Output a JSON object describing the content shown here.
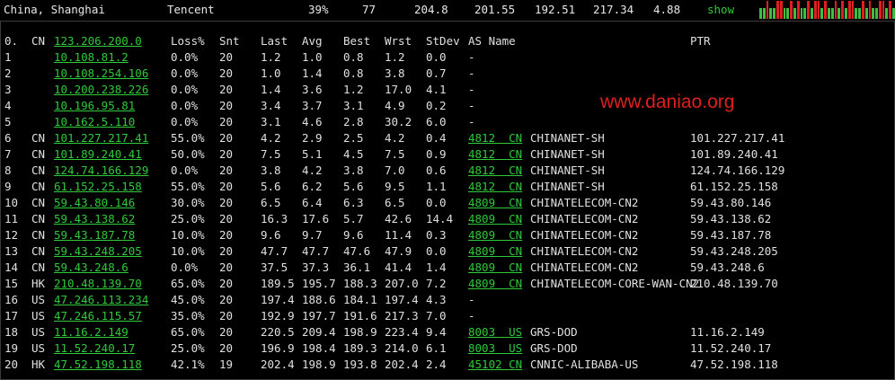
{
  "summary": {
    "location": "China, Shanghai",
    "provider": "Tencent",
    "loss": "39%",
    "sent": "77",
    "last": "204.8",
    "avg": "201.55",
    "best": "192.51",
    "worst": "217.34",
    "stdev": "4.88",
    "show_label": "show"
  },
  "mini_graph_colors": {
    "ok": "#3fbf3f",
    "loss": "#e02020"
  },
  "mini_graph": [
    1,
    1,
    0,
    1,
    1,
    0,
    0,
    1,
    1,
    0,
    1,
    0,
    1,
    1,
    0,
    1,
    0,
    0,
    1,
    0,
    1,
    1,
    0,
    1,
    0,
    1,
    0,
    0,
    1,
    1,
    0,
    1,
    0,
    1,
    1,
    0,
    0,
    1,
    0,
    1
  ],
  "header": {
    "hop": "0.",
    "cc": "CN",
    "host": "123.206.200.0",
    "loss": "Loss%",
    "snt": "Snt",
    "last": "Last",
    "avg": "Avg",
    "best": "Best",
    "wrst": "Wrst",
    "stdev": "StDev",
    "as_name": "AS Name",
    "ptr": "PTR"
  },
  "hops": [
    {
      "hop": "1",
      "cc": "",
      "host": "10.108.81.2",
      "loss": "0.0%",
      "snt": "20",
      "last": "1.2",
      "avg": "1.0",
      "best": "0.8",
      "wrst": "1.2",
      "stdev": "0.0",
      "asn": "",
      "as_name": "-",
      "ptr": ""
    },
    {
      "hop": "2",
      "cc": "",
      "host": "10.108.254.106",
      "loss": "0.0%",
      "snt": "20",
      "last": "1.0",
      "avg": "1.4",
      "best": "0.8",
      "wrst": "3.8",
      "stdev": "0.7",
      "asn": "",
      "as_name": "-",
      "ptr": ""
    },
    {
      "hop": "3",
      "cc": "",
      "host": "10.200.238.226",
      "loss": "0.0%",
      "snt": "20",
      "last": "1.4",
      "avg": "3.6",
      "best": "1.2",
      "wrst": "17.0",
      "stdev": "4.1",
      "asn": "",
      "as_name": "-",
      "ptr": ""
    },
    {
      "hop": "4",
      "cc": "",
      "host": "10.196.95.81",
      "loss": "0.0%",
      "snt": "20",
      "last": "3.4",
      "avg": "3.7",
      "best": "3.1",
      "wrst": "4.9",
      "stdev": "0.2",
      "asn": "",
      "as_name": "-",
      "ptr": ""
    },
    {
      "hop": "5",
      "cc": "",
      "host": "10.162.5.110",
      "loss": "0.0%",
      "snt": "20",
      "last": "3.1",
      "avg": "4.6",
      "best": "2.8",
      "wrst": "30.2",
      "stdev": "6.0",
      "asn": "",
      "as_name": "-",
      "ptr": ""
    },
    {
      "hop": "6",
      "cc": "CN",
      "host": "101.227.217.41",
      "loss": "55.0%",
      "snt": "20",
      "last": "4.2",
      "avg": "2.9",
      "best": "2.5",
      "wrst": "4.2",
      "stdev": "0.4",
      "asn": "4812  CN",
      "as_name": "CHINANET-SH",
      "ptr": "101.227.217.41"
    },
    {
      "hop": "7",
      "cc": "CN",
      "host": "101.89.240.41",
      "loss": "50.0%",
      "snt": "20",
      "last": "7.5",
      "avg": "5.1",
      "best": "4.5",
      "wrst": "7.5",
      "stdev": "0.9",
      "asn": "4812  CN",
      "as_name": "CHINANET-SH",
      "ptr": "101.89.240.41"
    },
    {
      "hop": "8",
      "cc": "CN",
      "host": "124.74.166.129",
      "loss": "0.0%",
      "snt": "20",
      "last": "3.8",
      "avg": "4.2",
      "best": "3.8",
      "wrst": "7.0",
      "stdev": "0.6",
      "asn": "4812  CN",
      "as_name": "CHINANET-SH",
      "ptr": "124.74.166.129"
    },
    {
      "hop": "9",
      "cc": "CN",
      "host": "61.152.25.158",
      "loss": "55.0%",
      "snt": "20",
      "last": "5.6",
      "avg": "6.2",
      "best": "5.6",
      "wrst": "9.5",
      "stdev": "1.1",
      "asn": "4812  CN",
      "as_name": "CHINANET-SH",
      "ptr": "61.152.25.158"
    },
    {
      "hop": "10",
      "cc": "CN",
      "host": "59.43.80.146",
      "loss": "30.0%",
      "snt": "20",
      "last": "6.5",
      "avg": "6.4",
      "best": "6.3",
      "wrst": "6.5",
      "stdev": "0.0",
      "asn": "4809  CN",
      "as_name": "CHINATELECOM-CN2",
      "ptr": "59.43.80.146"
    },
    {
      "hop": "11",
      "cc": "CN",
      "host": "59.43.138.62",
      "loss": "25.0%",
      "snt": "20",
      "last": "16.3",
      "avg": "17.6",
      "best": "5.7",
      "wrst": "42.6",
      "stdev": "14.4",
      "asn": "4809  CN",
      "as_name": "CHINATELECOM-CN2",
      "ptr": "59.43.138.62"
    },
    {
      "hop": "12",
      "cc": "CN",
      "host": "59.43.187.78",
      "loss": "10.0%",
      "snt": "20",
      "last": "9.6",
      "avg": "9.7",
      "best": "9.6",
      "wrst": "11.4",
      "stdev": "0.3",
      "asn": "4809  CN",
      "as_name": "CHINATELECOM-CN2",
      "ptr": "59.43.187.78"
    },
    {
      "hop": "13",
      "cc": "CN",
      "host": "59.43.248.205",
      "loss": "10.0%",
      "snt": "20",
      "last": "47.7",
      "avg": "47.7",
      "best": "47.6",
      "wrst": "47.9",
      "stdev": "0.0",
      "asn": "4809  CN",
      "as_name": "CHINATELECOM-CN2",
      "ptr": "59.43.248.205"
    },
    {
      "hop": "14",
      "cc": "CN",
      "host": "59.43.248.6",
      "loss": "0.0%",
      "snt": "20",
      "last": "37.5",
      "avg": "37.3",
      "best": "36.1",
      "wrst": "41.4",
      "stdev": "1.4",
      "asn": "4809  CN",
      "as_name": "CHINATELECOM-CN2",
      "ptr": "59.43.248.6"
    },
    {
      "hop": "15",
      "cc": "HK",
      "host": "210.48.139.70",
      "loss": "65.0%",
      "snt": "20",
      "last": "189.5",
      "avg": "195.7",
      "best": "188.3",
      "wrst": "207.0",
      "stdev": "7.2",
      "asn": "4809  CN",
      "as_name": "CHINATELECOM-CORE-WAN-CN2",
      "ptr": "210.48.139.70"
    },
    {
      "hop": "16",
      "cc": "US",
      "host": "47.246.113.234",
      "loss": "45.0%",
      "snt": "20",
      "last": "197.4",
      "avg": "188.6",
      "best": "184.1",
      "wrst": "197.4",
      "stdev": "4.3",
      "asn": "",
      "as_name": "-",
      "ptr": ""
    },
    {
      "hop": "17",
      "cc": "US",
      "host": "47.246.115.57",
      "loss": "35.0%",
      "snt": "20",
      "last": "192.9",
      "avg": "197.7",
      "best": "191.6",
      "wrst": "217.3",
      "stdev": "7.0",
      "asn": "",
      "as_name": "-",
      "ptr": ""
    },
    {
      "hop": "18",
      "cc": "US",
      "host": "11.16.2.149",
      "loss": "65.0%",
      "snt": "20",
      "last": "220.5",
      "avg": "209.4",
      "best": "198.9",
      "wrst": "223.4",
      "stdev": "9.4",
      "asn": "8003  US",
      "as_name": "GRS-DOD",
      "ptr": "11.16.2.149"
    },
    {
      "hop": "19",
      "cc": "US",
      "host": "11.52.240.17",
      "loss": "25.0%",
      "snt": "20",
      "last": "196.9",
      "avg": "198.4",
      "best": "189.3",
      "wrst": "214.0",
      "stdev": "6.1",
      "asn": "8003  US",
      "as_name": "GRS-DOD",
      "ptr": "11.52.240.17"
    },
    {
      "hop": "20",
      "cc": "HK",
      "host": "47.52.198.118",
      "loss": "42.1%",
      "snt": "19",
      "last": "202.4",
      "avg": "198.9",
      "best": "193.8",
      "wrst": "202.4",
      "stdev": "2.4",
      "asn": "45102 CN",
      "as_name": "CNNIC-ALIBABA-US",
      "ptr": "47.52.198.118"
    }
  ],
  "watermark": "www.daniao.org"
}
